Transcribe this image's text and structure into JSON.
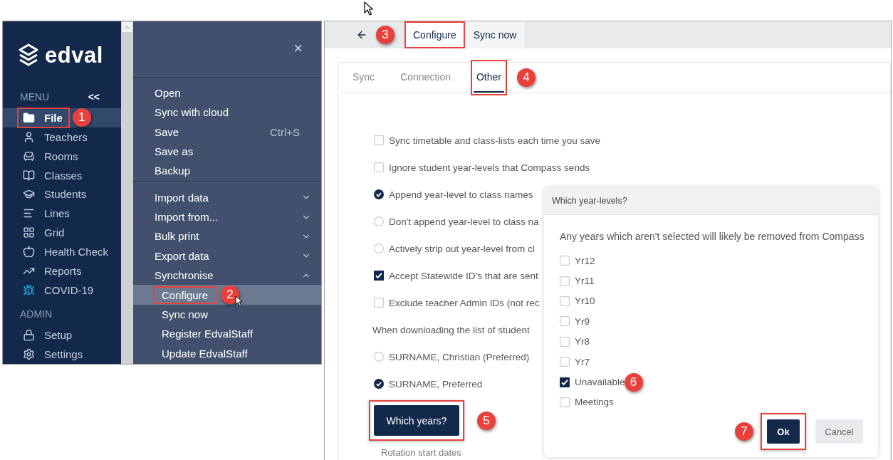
{
  "sidebar": {
    "logo_text": "edval",
    "menu_heading": "MENU",
    "collapse": "<<",
    "items": [
      {
        "label": "File",
        "selected": true,
        "highlighted": true,
        "callout": "1"
      },
      {
        "label": "Teachers",
        "selected": false
      },
      {
        "label": "Rooms",
        "selected": false
      },
      {
        "label": "Classes",
        "selected": false
      },
      {
        "label": "Students",
        "selected": false
      },
      {
        "label": "Lines",
        "selected": false
      },
      {
        "label": "Grid",
        "selected": false
      },
      {
        "label": "Health Check",
        "selected": false
      },
      {
        "label": "Reports",
        "selected": false
      },
      {
        "label": "COVID-19",
        "selected": false
      }
    ],
    "admin_heading": "ADMIN",
    "admin_items": [
      {
        "label": "Setup",
        "selected": false
      },
      {
        "label": "Settings",
        "selected": false
      }
    ]
  },
  "file_menu": {
    "close": "×",
    "groups": [
      {
        "items": [
          {
            "label": "Open"
          },
          {
            "label": "Sync with cloud"
          },
          {
            "label": "Save",
            "shortcut": "Ctrl+S"
          },
          {
            "label": "Save as"
          },
          {
            "label": "Backup"
          }
        ]
      },
      {
        "items": [
          {
            "label": "Import data",
            "expanded": false
          },
          {
            "label": "Import from...",
            "expanded": false
          },
          {
            "label": "Bulk print",
            "expanded": false
          },
          {
            "label": "Export data",
            "expanded": false
          },
          {
            "label": "Synchronise",
            "expanded": true,
            "children": [
              {
                "label": "Configure",
                "selected": true,
                "highlighted": true,
                "callout": "2"
              },
              {
                "label": "Sync now",
                "selected": false
              },
              {
                "label": "Register EdvalStaff",
                "selected": false
              },
              {
                "label": "Update EdvalStaff",
                "selected": false
              }
            ]
          }
        ]
      }
    ]
  },
  "top_tabs": [
    {
      "label": "Configure",
      "selected": true,
      "highlighted": true,
      "callout": "3"
    },
    {
      "label": "Sync now",
      "selected": false
    }
  ],
  "settings_card": {
    "tabs": [
      {
        "label": "Sync",
        "selected": false
      },
      {
        "label": "Connection",
        "selected": false
      },
      {
        "label": "Other",
        "selected": true,
        "highlighted": true,
        "callout": "4"
      }
    ],
    "options": [
      {
        "kind": "checkbox",
        "label": "Sync timetable and class-lists each time you save",
        "checked": false
      },
      {
        "kind": "checkbox",
        "label": "Ignore student year-levels that Compass sends",
        "checked": false
      },
      {
        "kind": "radio",
        "label": "Append year-level to class names",
        "checked": true
      },
      {
        "kind": "radio",
        "label": "Don't append year-level to class na",
        "checked": false
      },
      {
        "kind": "radio",
        "label": "Actively strip out year-level from cl",
        "checked": false
      },
      {
        "kind": "checkbox",
        "label": "Accept Statewide ID's that are sent",
        "checked": true
      },
      {
        "kind": "checkbox",
        "label": "Exclude teacher Admin IDs (not rec",
        "checked": false
      },
      {
        "kind": "text",
        "label": "When downloading the list of student"
      },
      {
        "kind": "radio",
        "label": "SURNAME, Christian (Preferred)",
        "checked": false
      },
      {
        "kind": "radio",
        "label": "SURNAME, Preferred",
        "checked": true
      }
    ],
    "button": {
      "label": "Which years?",
      "highlighted": true,
      "callout": "5"
    },
    "footer_text": "Rotation start dates"
  },
  "dialog": {
    "title": "Which year-levels?",
    "message": "Any years which aren't selected will likely be removed from Compass",
    "options": [
      {
        "label": "Yr12",
        "checked": false
      },
      {
        "label": "Yr11",
        "checked": false
      },
      {
        "label": "Yr10",
        "checked": false
      },
      {
        "label": "Yr9",
        "checked": false
      },
      {
        "label": "Yr8",
        "checked": false
      },
      {
        "label": "Yr7",
        "checked": false
      },
      {
        "label": "Unavailable",
        "checked": true,
        "callout": "6"
      },
      {
        "label": "Meetings",
        "checked": false
      }
    ],
    "buttons": [
      {
        "label": "Ok",
        "kind": "primary",
        "highlighted": true,
        "callout": "7"
      },
      {
        "label": "Cancel",
        "kind": "secondary",
        "highlighted": false
      }
    ]
  }
}
